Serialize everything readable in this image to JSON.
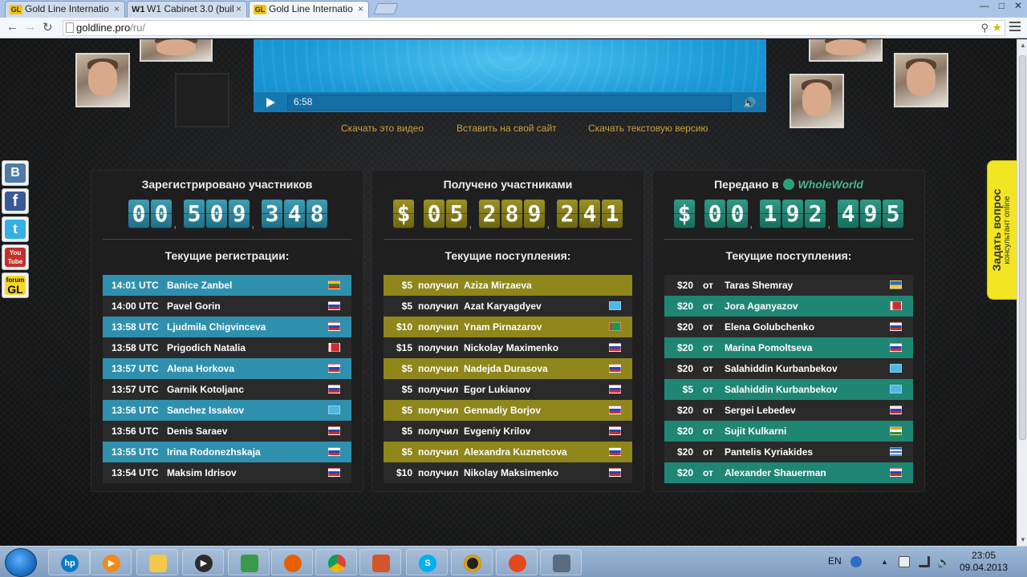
{
  "browser": {
    "tabs": [
      {
        "favicon": "GL",
        "title": "Gold Line Internatio"
      },
      {
        "favicon": "W1",
        "title": "W1 Cabinet 3.0 (buil"
      },
      {
        "favicon": "GL",
        "title": "Gold Line Internatio"
      }
    ],
    "tab_close": "×",
    "url_host": "goldline.pro",
    "url_path": "/ru/"
  },
  "video": {
    "time": "6:58",
    "links": [
      "Скачать это видео",
      "Вставить на свой сайт",
      "Скачать текстовую версию"
    ]
  },
  "panels": {
    "registered": {
      "title": "Зарегистрировано участников",
      "counter": [
        "0",
        "0",
        "5",
        "0",
        "9",
        "3",
        "4",
        "8"
      ],
      "subtitle": "Текущие регистрации:",
      "rows": [
        {
          "time": "14:01 UTC",
          "name": "Banice Zanbel",
          "flag": "lt"
        },
        {
          "time": "14:00 UTC",
          "name": "Pavel Gorin",
          "flag": "ru"
        },
        {
          "time": "13:58 UTC",
          "name": "Ljudmila Chigvinceva",
          "flag": "ru"
        },
        {
          "time": "13:58 UTC",
          "name": "Prigodich Natalia",
          "flag": "by"
        },
        {
          "time": "13:57 UTC",
          "name": "Alena Horkova",
          "flag": "ru"
        },
        {
          "time": "13:57 UTC",
          "name": "Garnik Kotoljanc",
          "flag": "ru"
        },
        {
          "time": "13:56 UTC",
          "name": "Sanchez Issakov",
          "flag": "kz"
        },
        {
          "time": "13:56 UTC",
          "name": "Denis Saraev",
          "flag": "ru"
        },
        {
          "time": "13:55 UTC",
          "name": "Irina Rodonezhskaja",
          "flag": "ru"
        },
        {
          "time": "13:54 UTC",
          "name": "Maksim Idrisov",
          "flag": "ru"
        }
      ]
    },
    "received": {
      "title": "Получено участниками",
      "counter": [
        "$",
        "0",
        "5",
        "2",
        "8",
        "9",
        "2",
        "4",
        "1"
      ],
      "subtitle": "Текущие поступления:",
      "rows": [
        {
          "amount": "$5",
          "verb": "получил",
          "name": "Aziza Mirzaeva",
          "flag": ""
        },
        {
          "amount": "$5",
          "verb": "получил",
          "name": "Azat Karyagdyev",
          "flag": "kz"
        },
        {
          "amount": "$10",
          "verb": "получил",
          "name": "Ynam Pirnazarov",
          "flag": "tm"
        },
        {
          "amount": "$15",
          "verb": "получил",
          "name": "Nickolay Maximenko",
          "flag": "ru"
        },
        {
          "amount": "$5",
          "verb": "получил",
          "name": "Nadejda Durasova",
          "flag": "ru"
        },
        {
          "amount": "$5",
          "verb": "получил",
          "name": "Egor Lukianov",
          "flag": "ru"
        },
        {
          "amount": "$5",
          "verb": "получил",
          "name": "Gennadiy Borjov",
          "flag": "ru"
        },
        {
          "amount": "$5",
          "verb": "получил",
          "name": "Evgeniy Krilov",
          "flag": "ru"
        },
        {
          "amount": "$5",
          "verb": "получил",
          "name": "Alexandra Kuznetcova",
          "flag": "ru"
        },
        {
          "amount": "$10",
          "verb": "получил",
          "name": "Nikolay Maksimenko",
          "flag": "ru"
        }
      ]
    },
    "transferred": {
      "title": "Передано в",
      "brand": "WholeWorld",
      "counter": [
        "$",
        "0",
        "0",
        "1",
        "9",
        "2",
        "4",
        "9",
        "5"
      ],
      "subtitle": "Текущие поступления:",
      "rows": [
        {
          "amount": "$20",
          "verb": "от",
          "name": "Taras Shemray",
          "flag": "ua"
        },
        {
          "amount": "$20",
          "verb": "от",
          "name": "Jora Aganyazov",
          "flag": "by"
        },
        {
          "amount": "$20",
          "verb": "от",
          "name": "Elena Golubchenko",
          "flag": "ru"
        },
        {
          "amount": "$20",
          "verb": "от",
          "name": "Marina Pomoltseva",
          "flag": "ru"
        },
        {
          "amount": "$20",
          "verb": "от",
          "name": "Salahiddin Kurbanbekov",
          "flag": "kz"
        },
        {
          "amount": "$5",
          "verb": "от",
          "name": "Salahiddin Kurbanbekov",
          "flag": "kz"
        },
        {
          "amount": "$20",
          "verb": "от",
          "name": "Sergei Lebedev",
          "flag": "ru"
        },
        {
          "amount": "$20",
          "verb": "от",
          "name": "Sujit Kulkarni",
          "flag": "in"
        },
        {
          "amount": "$20",
          "verb": "от",
          "name": "Pantelis Kyriakides",
          "flag": "gr"
        },
        {
          "amount": "$20",
          "verb": "от",
          "name": "Alexander Shauerman",
          "flag": "ru"
        }
      ]
    }
  },
  "social": {
    "vk": "B",
    "fb": "f",
    "tw": "t",
    "yt": "You Tube",
    "forum_top": "forum",
    "forum_bottom": "GL"
  },
  "ask": {
    "title": "Задать вопрос",
    "subtitle": "консультант online"
  },
  "taskbar": {
    "lang": "EN",
    "time": "23:05",
    "date": "09.04.2013",
    "hp": "hp"
  },
  "colors": {
    "registrations": "#2f90ae",
    "received": "#8f861c",
    "transferred": "#1f8673",
    "link": "#c8a23b"
  }
}
